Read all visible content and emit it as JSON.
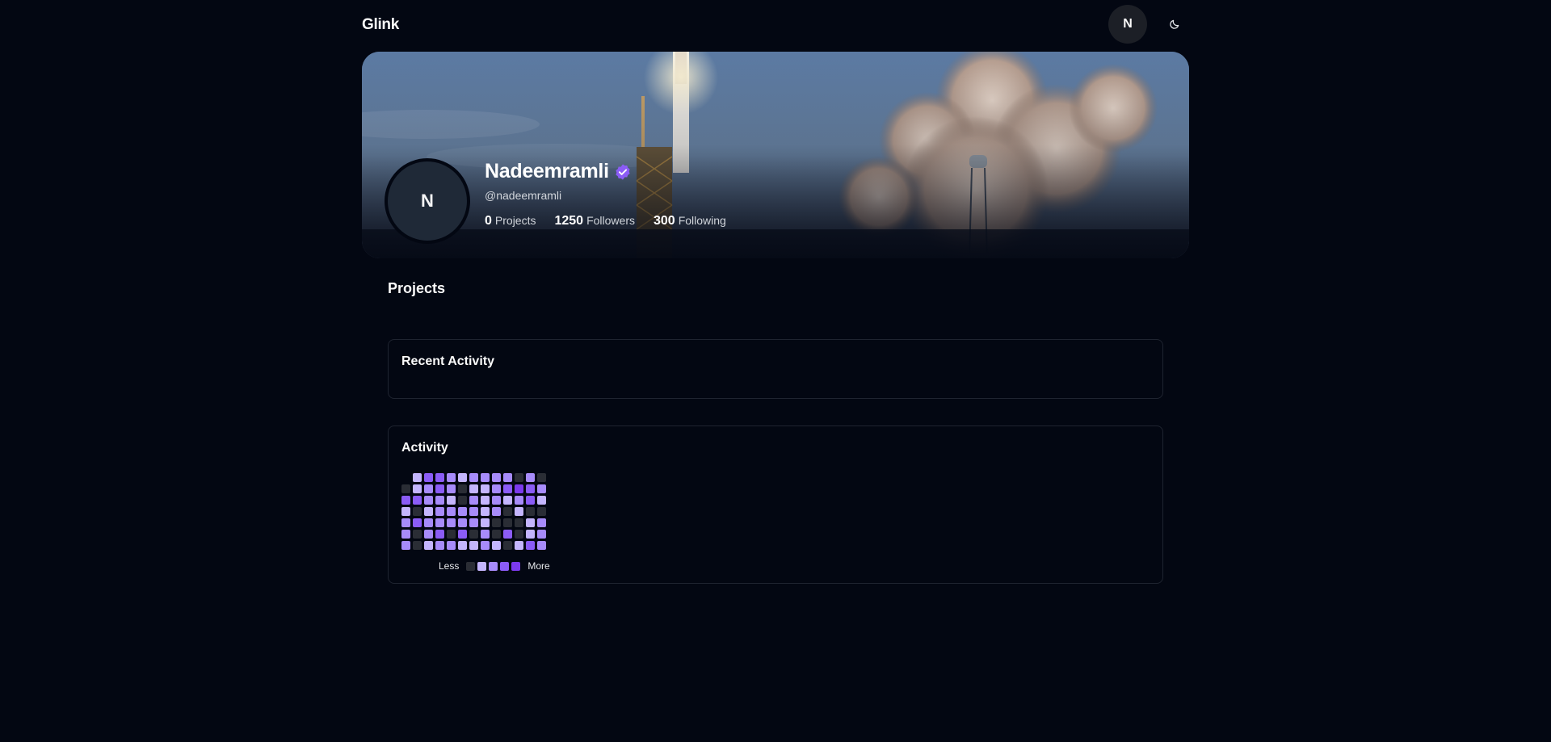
{
  "header": {
    "brand": "Glink",
    "avatar_initial": "N",
    "theme_toggle_icon": "moon-icon"
  },
  "profile": {
    "avatar_initial": "N",
    "name": "Nadeemramli",
    "verified_icon": "verified-badge-icon",
    "handle": "@nadeemramli",
    "stats": [
      {
        "value": "0",
        "label": "Projects"
      },
      {
        "value": "1250",
        "label": "Followers"
      },
      {
        "value": "300",
        "label": "Following"
      }
    ]
  },
  "sections": {
    "projects_title": "Projects",
    "recent_activity_title": "Recent Activity",
    "activity_title": "Activity"
  },
  "activity": {
    "legend_less": "Less",
    "legend_more": "More",
    "colors": [
      "#2a2d35",
      "#c4b5fd",
      "#a78bfa",
      "#8b5cf6",
      "#7c3aed"
    ],
    "grid": [
      [
        -1,
        1,
        3,
        3,
        2,
        1,
        2,
        2,
        2,
        2,
        0,
        2,
        0
      ],
      [
        0,
        1,
        2,
        3,
        2,
        0,
        1,
        1,
        2,
        3,
        4,
        3,
        2
      ],
      [
        3,
        3,
        2,
        2,
        1,
        0,
        2,
        1,
        2,
        1,
        2,
        3,
        1
      ],
      [
        1,
        0,
        1,
        2,
        2,
        2,
        2,
        1,
        2,
        0,
        1,
        0,
        0
      ],
      [
        2,
        3,
        2,
        2,
        2,
        2,
        2,
        1,
        0,
        0,
        0,
        1,
        2
      ],
      [
        2,
        0,
        2,
        3,
        0,
        3,
        0,
        2,
        0,
        3,
        0,
        1,
        2
      ],
      [
        2,
        0,
        1,
        2,
        2,
        1,
        1,
        2,
        1,
        0,
        1,
        3,
        2
      ]
    ]
  }
}
